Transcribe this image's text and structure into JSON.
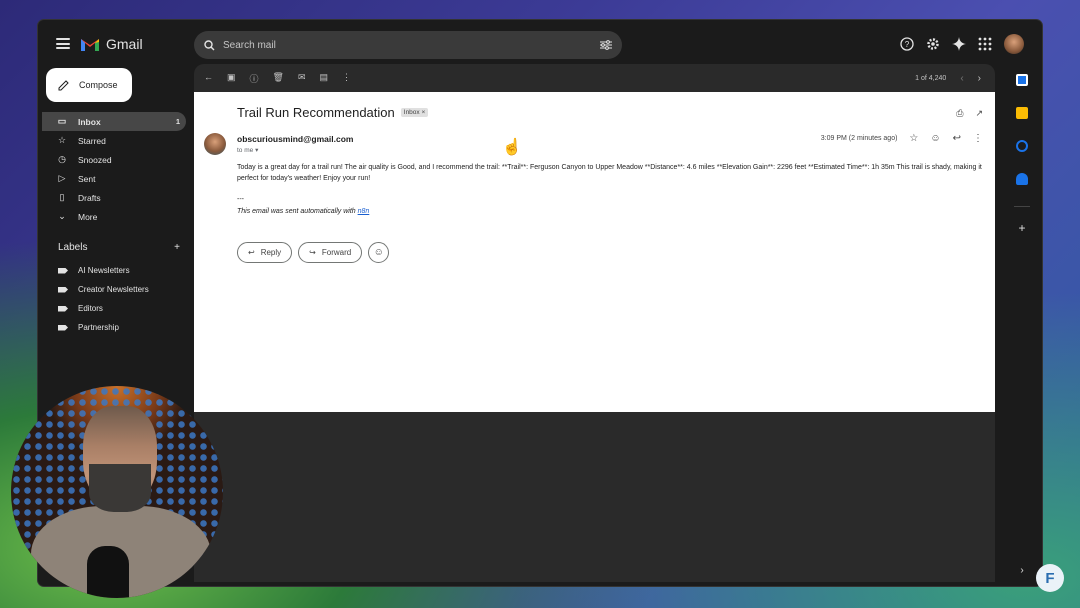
{
  "app": {
    "name": "Gmail"
  },
  "search": {
    "placeholder": "Search mail"
  },
  "compose": {
    "label": "Compose"
  },
  "nav": [
    {
      "label": "Inbox",
      "icon": "inbox-icon",
      "count": "1",
      "active": true
    },
    {
      "label": "Starred",
      "icon": "star-icon",
      "count": ""
    },
    {
      "label": "Snoozed",
      "icon": "clock-icon",
      "count": ""
    },
    {
      "label": "Sent",
      "icon": "send-icon",
      "count": ""
    },
    {
      "label": "Drafts",
      "icon": "draft-icon",
      "count": ""
    },
    {
      "label": "More",
      "icon": "chevron-down-icon",
      "count": ""
    }
  ],
  "labels": {
    "title": "Labels",
    "items": [
      "AI Newsletters",
      "Creator Newsletters",
      "Editors",
      "Partnership"
    ]
  },
  "toolbar": {
    "pager": "1 of 4,240"
  },
  "email": {
    "subject": "Trail Run Recommendation",
    "chip": "Inbox",
    "sender": "obscuriousmind@gmail.com",
    "to": "to me",
    "time": "3:09 PM (2 minutes ago)",
    "body": "Today is a great day for a trail run! The air quality is Good, and I recommend the trail: **Trail**: Ferguson Canyon to Upper Meadow **Distance**: 4.6 miles **Elevation Gain**: 2296 feet **Estimated Time**: 1h 35m This trail is shady, making it perfect for today's weather! Enjoy your run!",
    "sig_sep": "---",
    "sig_text": "This email was sent automatically with ",
    "sig_link": "n8n"
  },
  "actions": {
    "reply": "Reply",
    "forward": "Forward"
  },
  "colors": {
    "calendar": "#1a73e8",
    "keep": "#fbbc04",
    "tasks": "#1a73e8",
    "contacts": "#1a73e8"
  }
}
